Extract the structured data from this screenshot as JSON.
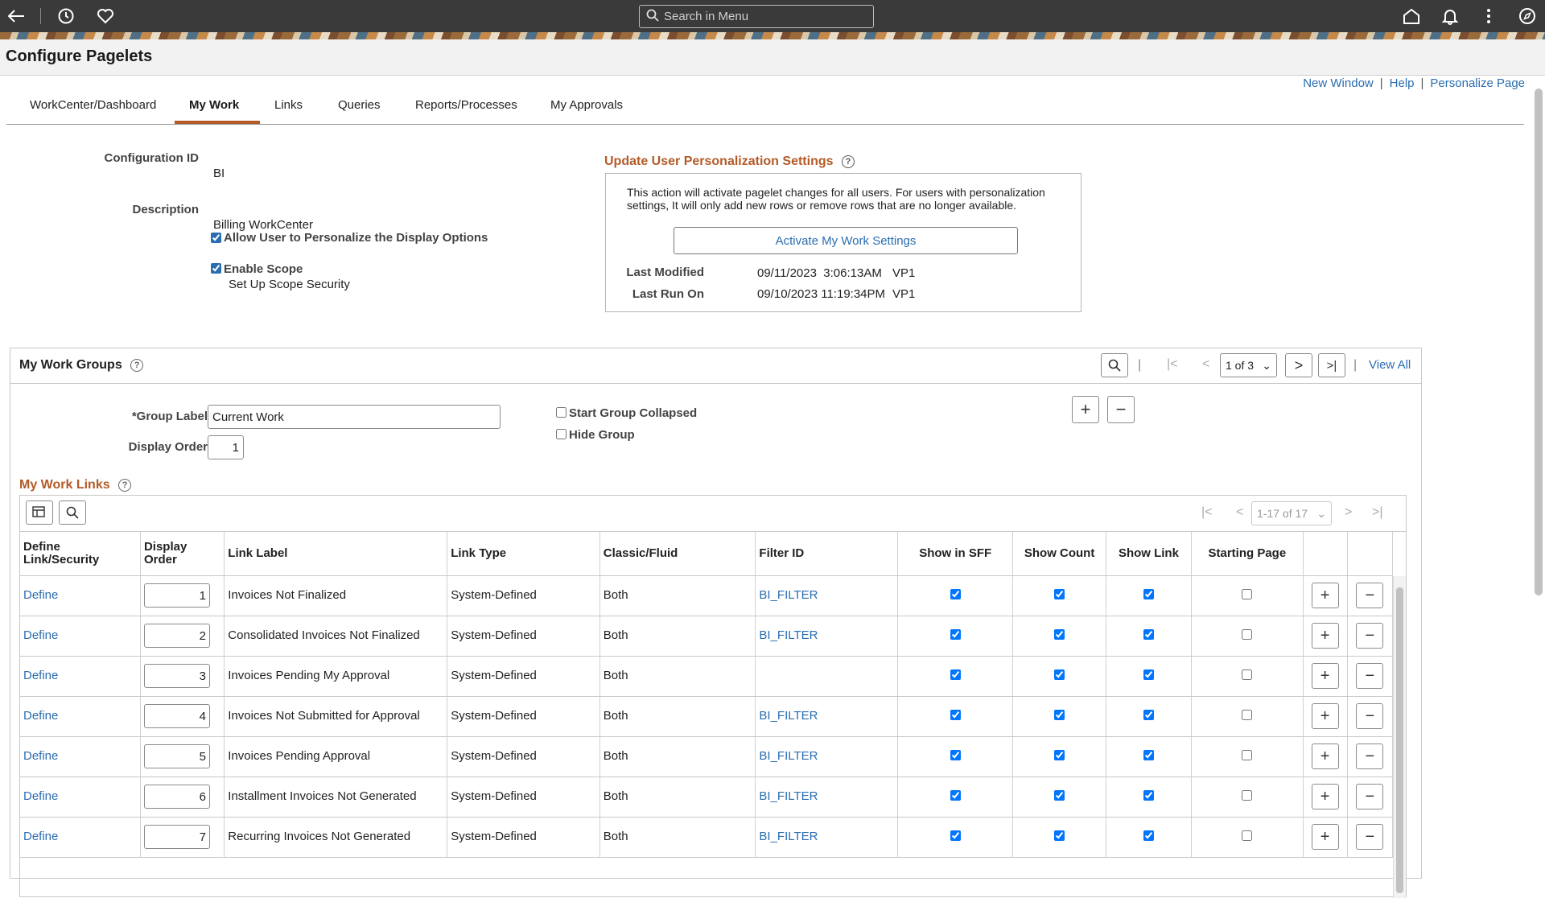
{
  "header": {
    "search_placeholder": "Search in Menu",
    "icons": [
      "back-arrow-icon",
      "recent-history-icon",
      "favorites-heart-icon",
      "home-icon",
      "notifications-bell-icon",
      "actions-menu-icon",
      "navbar-compass-icon"
    ]
  },
  "page": {
    "title": "Configure Pagelets",
    "top_links": [
      "New Window",
      "Help",
      "Personalize Page"
    ]
  },
  "tabs": [
    "WorkCenter/Dashboard",
    "My Work",
    "Links",
    "Queries",
    "Reports/Processes",
    "My Approvals"
  ],
  "active_tab": "My Work",
  "config": {
    "config_id_label": "Configuration ID",
    "config_id_value": "BI",
    "description_label": "Description",
    "description_value": "Billing WorkCenter",
    "allow_personalize_label": "Allow User to Personalize the Display Options",
    "allow_personalize_checked": true,
    "enable_scope_label": "Enable Scope",
    "enable_scope_checked": true,
    "scope_security_link": "Set Up Scope Security"
  },
  "update_settings": {
    "title": "Update User Personalization Settings",
    "text": "This action will activate pagelet changes for all users.  For users with personalization settings, It will only add new rows or remove rows that are no longer available.",
    "button": "Activate My Work Settings",
    "last_modified_label": "Last Modified",
    "last_modified_value": "09/11/2023  3:06:13AM",
    "last_modified_user": "VP1",
    "last_run_label": "Last Run On",
    "last_run_value": "09/10/2023 11:19:34PM",
    "last_run_user": "VP1"
  },
  "groups": {
    "title": "My Work Groups",
    "pager": "1 of 3",
    "view_all": "View All",
    "group_label_label": "*Group Label",
    "group_label_value": "Current Work",
    "display_order_label": "Display Order",
    "display_order_value": "1",
    "start_collapsed_label": "Start Group Collapsed",
    "hide_group_label": "Hide Group"
  },
  "links": {
    "title": "My Work Links",
    "pager": "1-17 of 17",
    "columns": [
      "Define Link/Security",
      "Display Order",
      "Link Label",
      "Link Type",
      "Classic/Fluid",
      "Filter ID",
      "Show in SFF",
      "Show Count",
      "Show Link",
      "Starting Page"
    ],
    "rows": [
      {
        "define": "Define",
        "order": "1",
        "label": "Invoices Not Finalized",
        "type": "System-Defined",
        "cf": "Both",
        "filter": "BI_FILTER"
      },
      {
        "define": "Define",
        "order": "2",
        "label": "Consolidated Invoices Not Finalized",
        "type": "System-Defined",
        "cf": "Both",
        "filter": "BI_FILTER"
      },
      {
        "define": "Define",
        "order": "3",
        "label": "Invoices Pending My Approval",
        "type": "System-Defined",
        "cf": "Both",
        "filter": ""
      },
      {
        "define": "Define",
        "order": "4",
        "label": "Invoices Not Submitted for Approval",
        "type": "System-Defined",
        "cf": "Both",
        "filter": "BI_FILTER"
      },
      {
        "define": "Define",
        "order": "5",
        "label": "Invoices Pending Approval",
        "type": "System-Defined",
        "cf": "Both",
        "filter": "BI_FILTER"
      },
      {
        "define": "Define",
        "order": "6",
        "label": "Installment Invoices Not Generated",
        "type": "System-Defined",
        "cf": "Both",
        "filter": "BI_FILTER"
      },
      {
        "define": "Define",
        "order": "7",
        "label": "Recurring Invoices Not Generated",
        "type": "System-Defined",
        "cf": "Both",
        "filter": "BI_FILTER"
      }
    ]
  },
  "colors": {
    "topbar": "#3a3a3a",
    "accent_orange": "#b35a27",
    "link_blue": "#2a6db0"
  }
}
